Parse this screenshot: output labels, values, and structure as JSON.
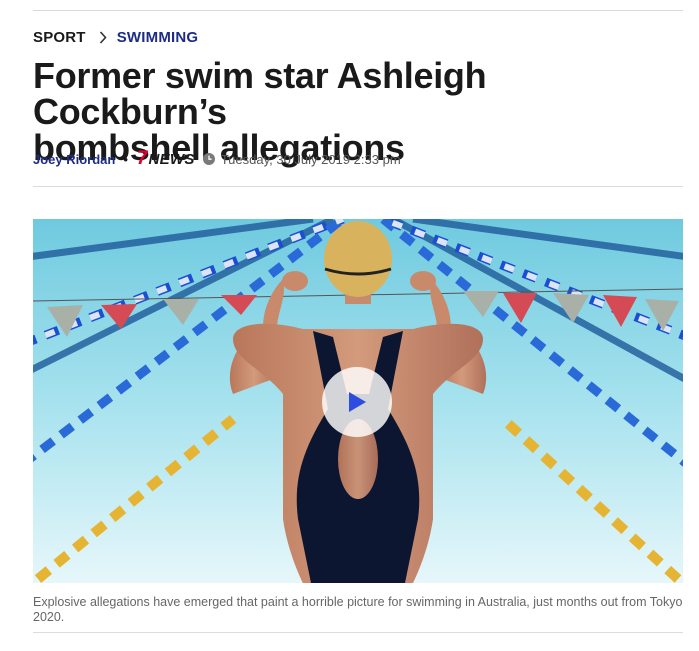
{
  "breadcrumb": {
    "section": "SPORT",
    "separator": "chevron-right-icon",
    "subsection": "SWIMMING"
  },
  "article": {
    "headline_line1": "Former swim star Ashleigh Cockburn’s",
    "headline_line2": "bombshell allegations",
    "author": "Joey Riordan",
    "separator": "•",
    "publisher_logo": {
      "number": "7",
      "word": "NEWS"
    },
    "published": "Tuesday, 30 July 2019 2:33 pm"
  },
  "media": {
    "type": "video",
    "play_icon": "play-icon",
    "caption": "Explosive allegations have emerged that paint a horrible picture for swimming in Australia, just months out from Tokyo 2020."
  },
  "colors": {
    "brand_blue": "#1d2d86",
    "brand_red": "#e4002b",
    "play_triangle": "#2c4de0"
  }
}
